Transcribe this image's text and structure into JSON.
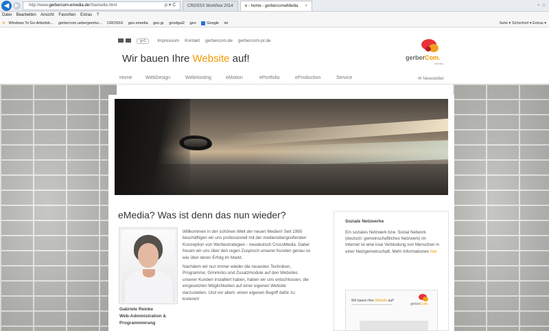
{
  "browser": {
    "url_prefix": "http://www.",
    "url_host": "gerbercom-emedia.de",
    "url_path": "/Startseite.html",
    "url_controls": "ρ ▾ C",
    "tabs": [
      {
        "label": "CROSSX Workflow 2014"
      },
      {
        "label": "e - home - gerbercomeMedia",
        "close": "×"
      }
    ],
    "window_controls": "◔ ☆",
    "menu": [
      "Datei",
      "Bearbeiten",
      "Ansicht",
      "Favoriten",
      "Extras",
      "?"
    ],
    "favorites": [
      "Windows To Go-Arbeitsb...",
      "gerbercom.uebergeortur...",
      "CROSSX",
      "geo.emedia",
      "geo.gr",
      "goodgui2",
      "geo",
      "Google",
      "ist"
    ],
    "toolbar_right": "Seite ▾  Sicherheit ▾  Extras ▾"
  },
  "site": {
    "top_links": [
      "Impressum",
      "Kontakt",
      "gerbercom.de",
      "gerbercom-pr.de"
    ],
    "gplus": "g+1",
    "headline_start": "Wir bauen Ihre ",
    "headline_highlight": "Website",
    "headline_end": " auf!",
    "logo_text": "gerber",
    "logo_text_2": "Com.",
    "logo_tagline": "eMedia",
    "nav": [
      "Home",
      "WebDesign",
      "WebHosting",
      "eMotion",
      "ePortfolio",
      "eProduction",
      "Service"
    ],
    "newsletter": "Newsletter"
  },
  "main": {
    "title": "eMedia? Was ist denn das nun wieder?",
    "intro_p1": "Willkommen in der schönen Welt der neuen Medien! Seit 1995 beschäftigen wir uns professionell mit der medienübergreifenden Konzeption von Werbestrategien - neudeutsch CrossMedia. Dabei freuen wir uns über den regen Zuspruch unserer Kunden genau so wie über deren Erfolg im Markt.",
    "intro_p2": "Nachdem wir nun immer wieder die neuesten Techniken, Programme, Gimmicks und Zusatzmodule auf den Websites unserer Kunden installiert haben, haben wir uns entschlossen, die eingesetzten Möglichkeiten auf einer eigenen Website darzustellen. Und vor allem: einen eigenen Begriff dafür zu kreieren!",
    "caption_name": "Gabriele Reinke",
    "caption_role_1": "Web-Administration &",
    "caption_role_2": "Programmierung"
  },
  "sidebar": {
    "title": "Soziale Netzwerke",
    "text": "Ein soziales Netzwerk bzw. Social Network (deutsch: gemeinschaftliches Netzwerk) im Internet ist eine lose Verbindung von Menschen in einer Netzgemeinschaft. Mehr Informationen",
    "more": "hier",
    "thumb_title_start": "Wir bauen Ihre ",
    "thumb_title_hl": "Website",
    "thumb_title_end": " auf!"
  },
  "colors": {
    "accent": "#f29a00",
    "logo_red": "#e8323a",
    "ie_blue": "#1e73c9"
  }
}
